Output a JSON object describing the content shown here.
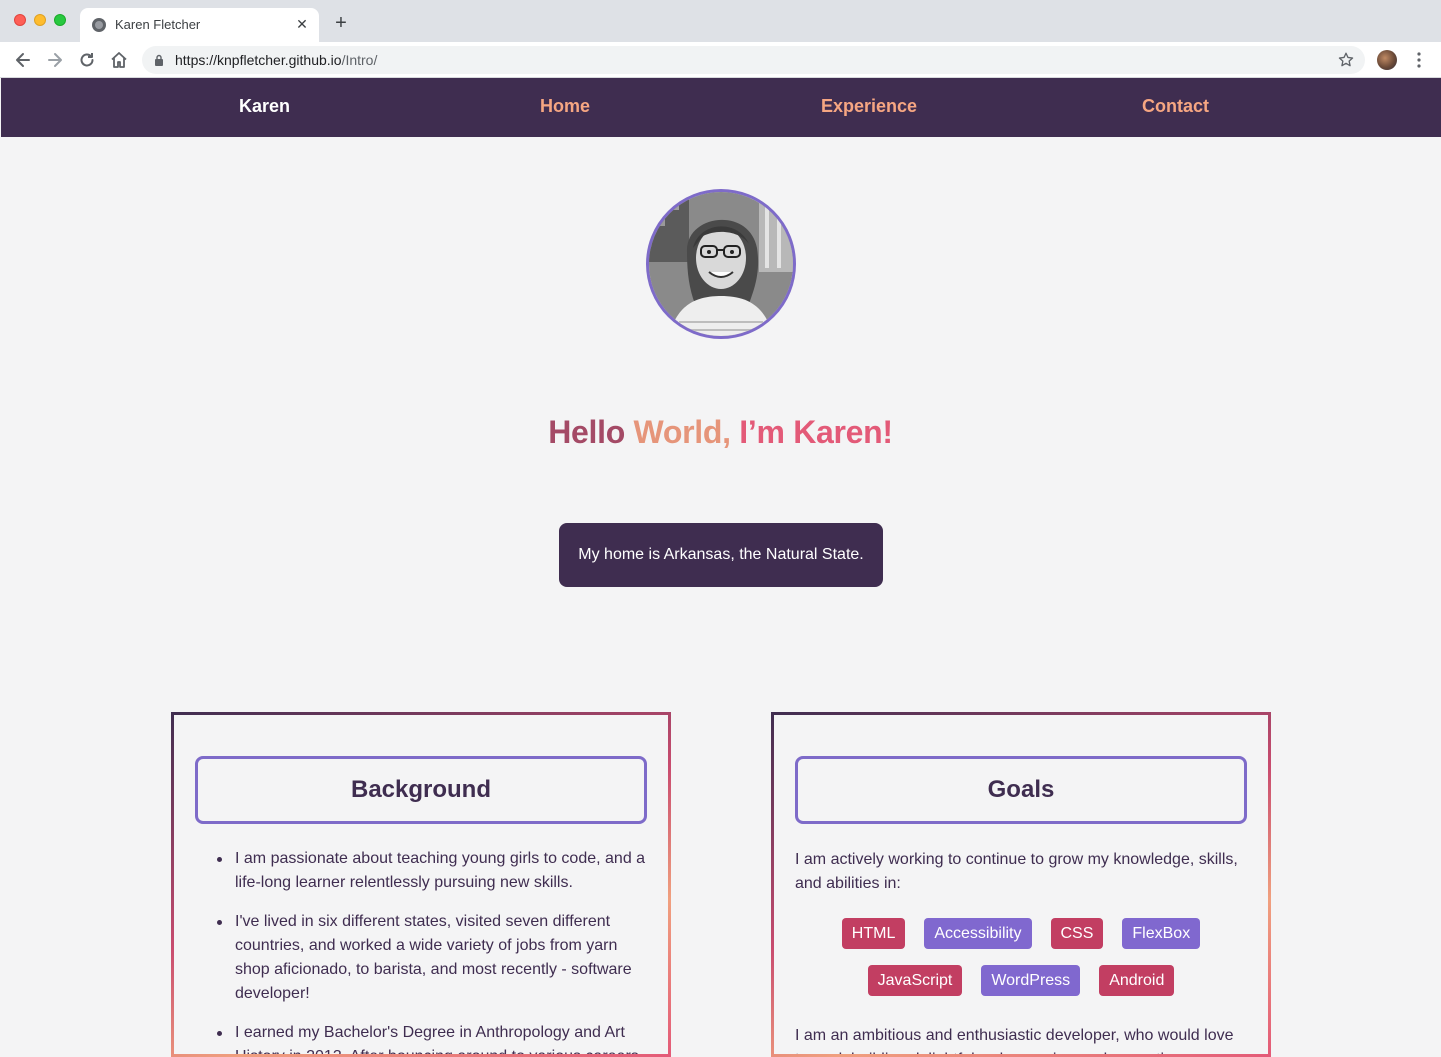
{
  "browser": {
    "tab_title": "Karen Fletcher",
    "tab_close": "✕",
    "new_tab": "+",
    "url_host": "https://knpfletcher.github.io",
    "url_path": "/Intro/"
  },
  "nav": {
    "brand": "Karen",
    "links": [
      "Home",
      "Experience",
      "Contact"
    ]
  },
  "hero": {
    "hello_1": "Hello",
    "hello_2": "World,",
    "hello_3": "I’m Karen!",
    "home": "My home is Arkansas, the Natural State."
  },
  "background": {
    "title": "Background",
    "items": [
      "I am passionate about teaching young girls to code, and a life-long learner relentlessly pursuing new skills.",
      "I've lived in six different states, visited seven different countries, and worked a wide variety of jobs from yarn shop aficionado, to barista, and most recently - software developer!",
      "I earned my Bachelor's Degree in Anthropology and Art History in 2013. After bouncing around to various careers"
    ]
  },
  "goals": {
    "title": "Goals",
    "intro": "I am actively working to continue to grow my knowledge, skills, and abilities in:",
    "skills": [
      {
        "label": "HTML",
        "color": "#c23e62"
      },
      {
        "label": "Accessibility",
        "color": "#8068cf"
      },
      {
        "label": "CSS",
        "color": "#c23e62"
      },
      {
        "label": "FlexBox",
        "color": "#8068cf"
      },
      {
        "label": "JavaScript",
        "color": "#c23e62"
      },
      {
        "label": "WordPress",
        "color": "#8068cf"
      },
      {
        "label": "Android",
        "color": "#c23e62"
      }
    ],
    "outro": "I am an ambitious and enthusiastic developer, who would love to work building delightful web experiences by creating"
  },
  "colors": {
    "nav_bg": "#3f2d50",
    "nav_link": "#f6a682",
    "accent_purple": "#7e6bc9",
    "accent_red": "#c23e62"
  }
}
